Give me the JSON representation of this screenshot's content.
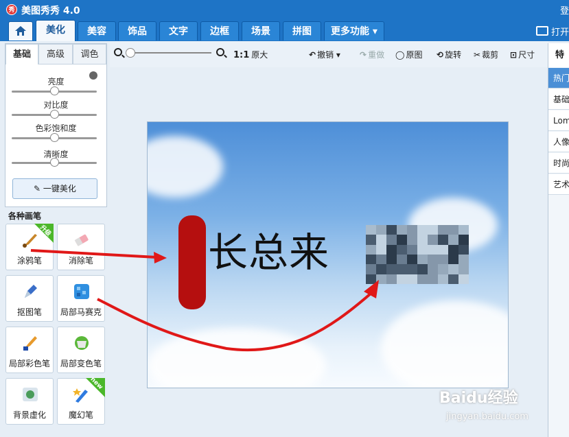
{
  "app": {
    "title": "美图秀秀 4.0",
    "logo_text": "秀",
    "login": "登"
  },
  "tabs": [
    {
      "label": ""
    },
    {
      "label": "美化"
    },
    {
      "label": "美容"
    },
    {
      "label": "饰品"
    },
    {
      "label": "文字"
    },
    {
      "label": "边框"
    },
    {
      "label": "场景"
    },
    {
      "label": "拼图"
    },
    {
      "label": "更多功能 ▾"
    }
  ],
  "open_label": "打开",
  "toolbar": {
    "ratio_bold": "1:1",
    "ratio_label": "原大",
    "undo": "撤销",
    "redo": "重做",
    "original": "原图",
    "rotate": "旋转",
    "crop": "裁剪",
    "size": "尺寸"
  },
  "left": {
    "subtabs": [
      "基础",
      "高级",
      "调色"
    ],
    "sliders": [
      {
        "label": "亮度",
        "value": 50
      },
      {
        "label": "对比度",
        "value": 50
      },
      {
        "label": "色彩饱和度",
        "value": 50
      },
      {
        "label": "清晰度",
        "value": 50
      }
    ],
    "onekey": "一键美化",
    "pens_title": "各种画笔",
    "pens": [
      {
        "label": "涂鸦笔",
        "badge": "升级"
      },
      {
        "label": "消除笔",
        "badge": ""
      },
      {
        "label": "抠图笔",
        "badge": ""
      },
      {
        "label": "局部马赛克",
        "badge": ""
      },
      {
        "label": "局部彩色笔",
        "badge": ""
      },
      {
        "label": "局部变色笔",
        "badge": ""
      },
      {
        "label": "背景虚化",
        "badge": ""
      },
      {
        "label": "魔幻笔",
        "badge": "new"
      }
    ]
  },
  "photo": {
    "text": "长总来"
  },
  "right": {
    "title": "特效",
    "items": [
      {
        "label": "热门"
      },
      {
        "label": "基础"
      },
      {
        "label": "Lomo"
      },
      {
        "label": "人像"
      },
      {
        "label": "时尚"
      },
      {
        "label": "艺术"
      }
    ]
  },
  "watermark": {
    "main": "Baidu经验",
    "sub": "jingyan.baidu.com"
  },
  "colors": {
    "brand": "#1e74c6",
    "annotation_red": "#e01818"
  }
}
